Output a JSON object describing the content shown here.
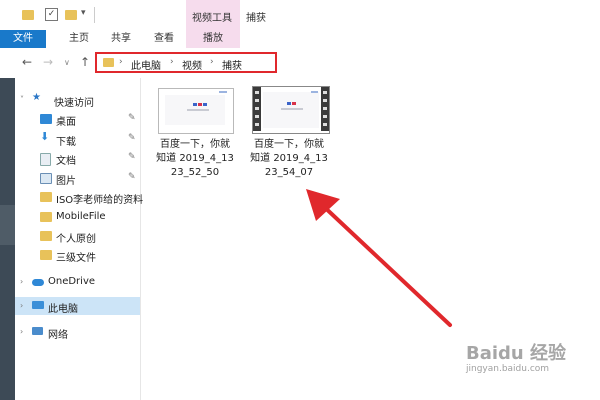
{
  "titlebar": {
    "context_tab": "视频工具",
    "window_title": "捕获"
  },
  "ribbon": {
    "tabs": [
      {
        "label": "文件"
      },
      {
        "label": "主页"
      },
      {
        "label": "共享"
      },
      {
        "label": "查看"
      },
      {
        "label": "播放"
      }
    ]
  },
  "address": {
    "crumbs": [
      "此电脑",
      "视频",
      "捕获"
    ]
  },
  "sidebar": {
    "items": [
      {
        "label": "快速访问",
        "icon": "star-icon"
      },
      {
        "label": "桌面",
        "icon": "desktop-icon",
        "pinned": true
      },
      {
        "label": "下载",
        "icon": "download-icon",
        "pinned": true
      },
      {
        "label": "文档",
        "icon": "document-icon",
        "pinned": true
      },
      {
        "label": "图片",
        "icon": "picture-icon",
        "pinned": true
      },
      {
        "label": "ISO李老师给的资料",
        "icon": "folder-icon"
      },
      {
        "label": "MobileFile",
        "icon": "folder-icon"
      },
      {
        "label": "个人原创",
        "icon": "folder-icon"
      },
      {
        "label": "三级文件",
        "icon": "folder-icon"
      },
      {
        "label": "OneDrive",
        "icon": "cloud-icon"
      },
      {
        "label": "此电脑",
        "icon": "computer-icon",
        "selected": true
      },
      {
        "label": "网络",
        "icon": "network-icon"
      }
    ]
  },
  "files": [
    {
      "lines": [
        "百度一下，你就",
        "知道 2019_4_13",
        "23_52_50"
      ],
      "type": "image"
    },
    {
      "lines": [
        "百度一下，你就",
        "知道 2019_4_13",
        "23_54_07"
      ],
      "type": "video"
    }
  ],
  "watermark": {
    "logo": "Baidu 经验",
    "url": "jingyan.baidu.com"
  },
  "colors": {
    "accent": "#1979ca",
    "context_tab": "#f6dced",
    "highlight": "#e0282c",
    "selection": "#cce4f7"
  }
}
